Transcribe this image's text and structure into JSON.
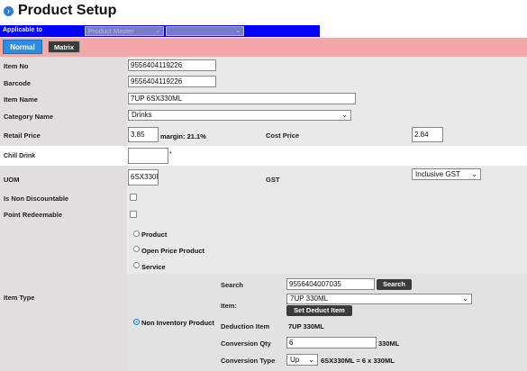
{
  "header": {
    "icon": "chevron-right-icon",
    "title": "Product Setup"
  },
  "applicable": {
    "label": "Applicable to",
    "select1": "Product Master",
    "select2": ""
  },
  "tabs": {
    "normal": "Normal",
    "matrix": "Matrix"
  },
  "fields": {
    "item_no": {
      "label": "Item No",
      "value": "9556404119226"
    },
    "barcode": {
      "label": "Barcode",
      "value": "9556404119226"
    },
    "item_name": {
      "label": "Item Name",
      "value": "7UP 6SX330ML"
    },
    "category": {
      "label": "Category Name",
      "value": "Drinks"
    },
    "retail_price": {
      "label": "Retail Price",
      "value": "3.85",
      "margin": "margin: 21.1%"
    },
    "cost_price": {
      "label": "Cost Price",
      "value": "2.84"
    },
    "chill_drink": {
      "label": "Chill Drink",
      "value": "",
      "suffix": "*"
    },
    "uom": {
      "label": "UOM",
      "value": "6SX330ML"
    },
    "gst": {
      "label": "GST",
      "value": "Inclusive GST"
    },
    "non_discountable": {
      "label": "Is Non Discountable",
      "checked": false
    },
    "point_redeemable": {
      "label": "Point Redeemable",
      "checked": false
    }
  },
  "item_type": {
    "label": "Item Type",
    "options": [
      "Product",
      "Open Price Product",
      "Service",
      "Non Inventory Product"
    ],
    "selected": "Non Inventory Product",
    "search_label": "Search",
    "search_value": "9556404007035",
    "search_button": "Search",
    "item_label": "Item:",
    "item_value": "7UP 330ML",
    "set_deduct_button": "Set Deduct Item",
    "deduction_label": "Deduction Item",
    "deduction_value": "7UP 330ML",
    "conversion_qty_label": "Conversion Qty",
    "conversion_qty_value": "6",
    "conversion_qty_unit": "330ML",
    "conversion_type_label": "Conversion Type",
    "conversion_type_value": "Up",
    "conversion_formula": "6SX330ML = 6 x 330ML"
  },
  "colors": {
    "accent": "#2a8fe0",
    "applicable_bar": "#0000ff",
    "tab_bar": "#f2a8a6",
    "dark_button": "#3b3b3b"
  }
}
